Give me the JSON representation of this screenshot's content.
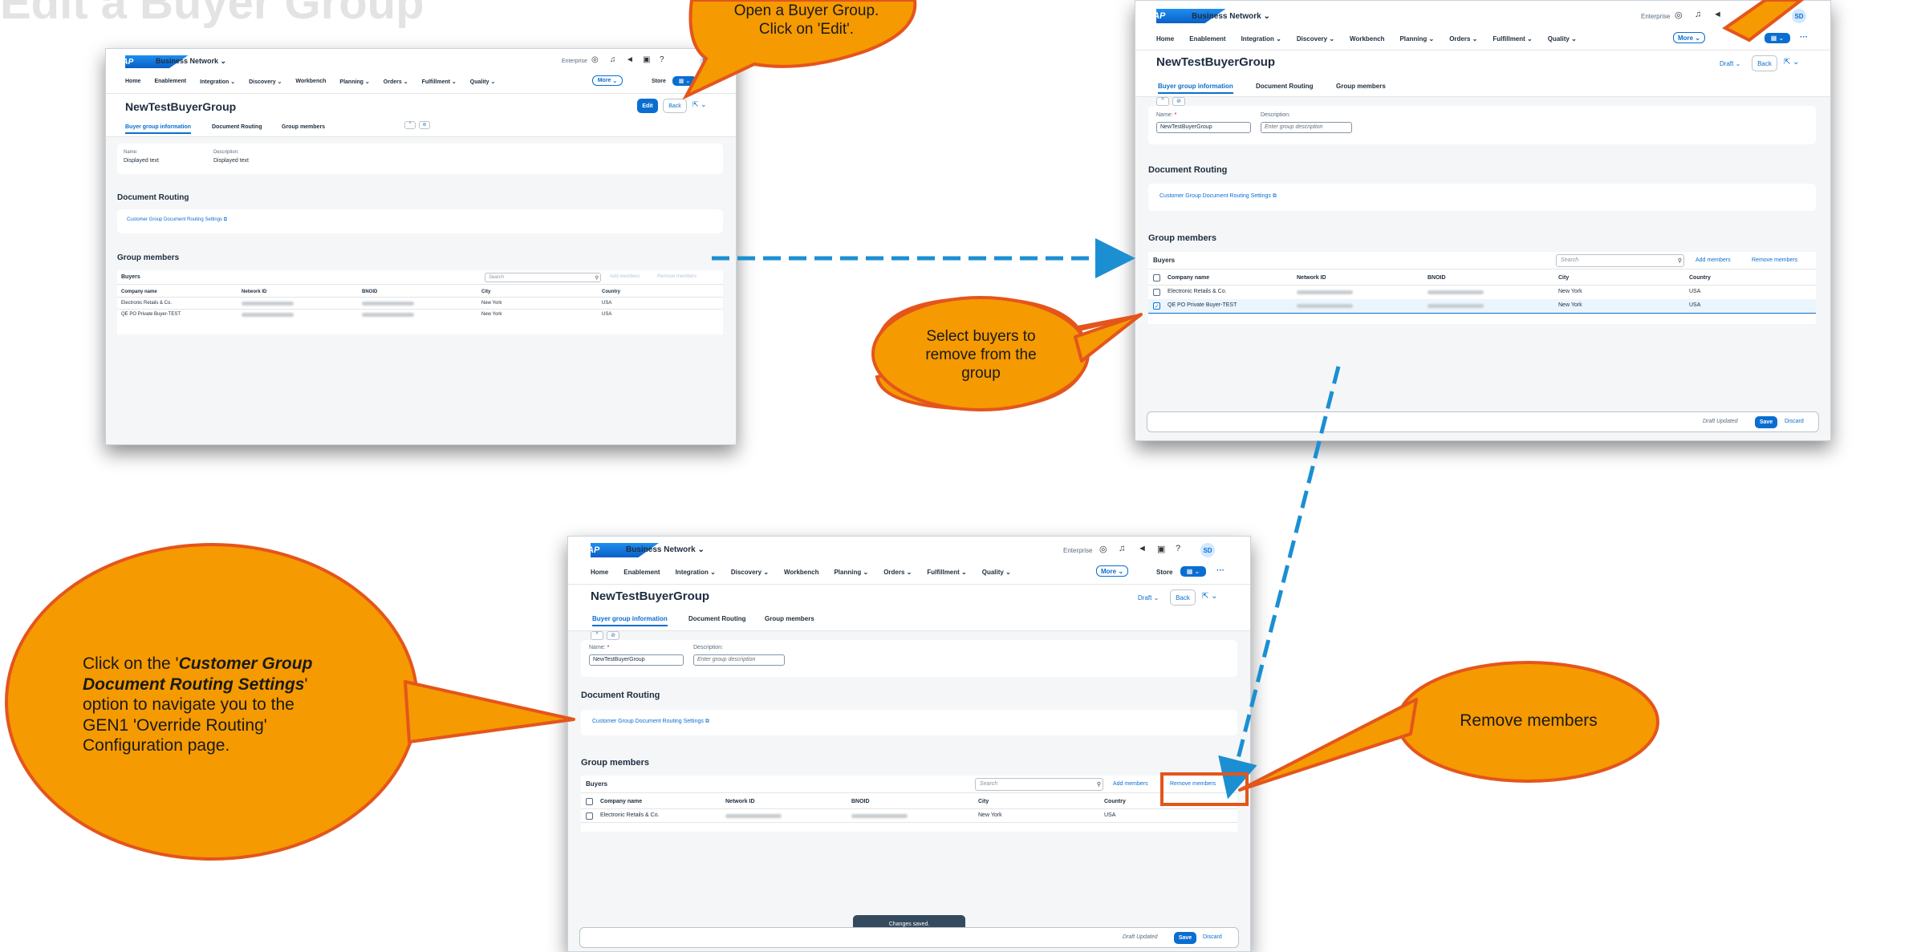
{
  "slide": {
    "title": "Edit a Buyer Group"
  },
  "callouts": {
    "open_edit": "Open a Buyer Group. Click on 'Edit'.",
    "select_buyers": "Select buyers to remove from the group",
    "remove_members": "Remove members",
    "routing_pre": "Click on the '",
    "routing_bold": "Customer Group Document Routing Settings",
    "routing_post": "' option to navigate you to the GEN1 'Override Routing' Configuration page."
  },
  "app": {
    "brand": "Business Network",
    "logo": "SAP",
    "enterprise": "Enterprise",
    "avatar": "SD",
    "nav": [
      "Home",
      "Enablement",
      "Integration",
      "Discovery",
      "Workbench",
      "Planning",
      "Orders",
      "Fulfillment",
      "Quality"
    ],
    "more": "More",
    "store": "Store"
  },
  "page": {
    "title": "NewTestBuyerGroup",
    "tabs": [
      "Buyer group information",
      "Document Routing",
      "Group members"
    ],
    "edit": "Edit",
    "back": "Back",
    "draft": "Draft"
  },
  "form": {
    "name_label": "Name:",
    "desc_label": "Description:",
    "displayed_text": "Displayed text",
    "name_value": "NewTestBuyerGroup",
    "desc_placeholder": "Enter group description"
  },
  "routing": {
    "title": "Document Routing",
    "link": "Customer Group Document Routing Settings"
  },
  "members": {
    "title": "Group members",
    "table_title": "Buyers",
    "search_placeholder": "Search",
    "add": "Add members",
    "remove": "Remove members",
    "columns": [
      "Company name",
      "Network ID",
      "BNOID",
      "City",
      "Country"
    ],
    "rows": [
      {
        "company": "Electronic Retails & Co.",
        "city": "New York",
        "country": "USA"
      },
      {
        "company": "QE PO Private Buyer-TEST",
        "city": "New York",
        "country": "USA"
      }
    ]
  },
  "footer": {
    "draft_updated": "Draft Updated",
    "save": "Save",
    "discard": "Discard"
  },
  "toast": "Changes saved.",
  "colors": {
    "accent": "#0a6ed1",
    "callout_fill": "#f59a00",
    "callout_stroke": "#e4551d",
    "arrow": "#1b8fd2"
  }
}
